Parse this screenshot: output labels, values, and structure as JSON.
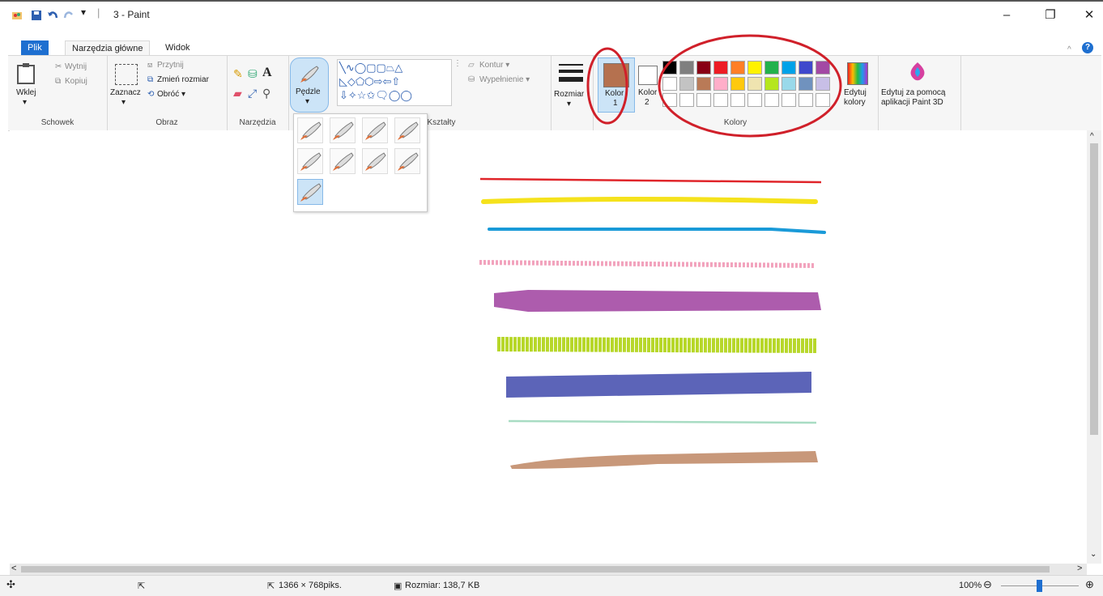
{
  "window": {
    "title": "3 - Paint",
    "minimize_glyph": "–",
    "maximize_glyph": "❐",
    "close_glyph": "✕"
  },
  "tabs": {
    "file": "Plik",
    "home": "Narzędzia główne",
    "view": "Widok"
  },
  "clipboard": {
    "paste": "Wklej",
    "cut": "Wytnij",
    "copy": "Kopiuj",
    "group": "Schowek"
  },
  "image": {
    "select": "Zaznacz",
    "crop": "Przytnij",
    "resize": "Zmień rozmiar",
    "rotate": "Obróć ▾",
    "group": "Obraz"
  },
  "tools": {
    "group": "Narzędzia",
    "text_glyph": "A"
  },
  "brushes": {
    "label": "Pędzle"
  },
  "shapes": {
    "outline": "Kontur ▾",
    "fill": "Wypełnienie ▾",
    "group": "Kształty",
    "row1": "╲∿◯▢▢⏢△",
    "row2": "◺◇⬠⬡⇨⇦⇧",
    "row3": "⇩✧☆✩🗨◯◯"
  },
  "size": {
    "label": "Rozmiar"
  },
  "colors": {
    "color1": "Kolor",
    "color1_num": "1",
    "color2": "Kolor",
    "color2_num": "2",
    "group": "Kolory",
    "edit": "Edytuj",
    "edit2": "kolory",
    "color1_value": "#b5714f",
    "palette_row1": [
      "#000000",
      "#7f7f7f",
      "#880015",
      "#ed1c24",
      "#ff7f27",
      "#fff200",
      "#22b14c",
      "#00a2e8",
      "#3f48cc",
      "#a349a4"
    ],
    "palette_row2": [
      "#ffffff",
      "#c3c3c3",
      "#b97a57",
      "#ffaec9",
      "#ffc90e",
      "#efe4b0",
      "#b5e61d",
      "#99d9ea",
      "#7092be",
      "#c8bfe7"
    ]
  },
  "paint3d": {
    "line1": "Edytuj za pomocą",
    "line2": "aplikacji Paint 3D"
  },
  "status": {
    "dimensions": "1366 × 768piks.",
    "filesize": "Rozmiar: 138,7 KB",
    "zoom": "100%"
  },
  "strokes": [
    {
      "color": "#e0252a",
      "style": "pen"
    },
    {
      "color": "#f5e21c",
      "style": "brush"
    },
    {
      "color": "#1a9ad8",
      "style": "brush"
    },
    {
      "color": "#f2a3bd",
      "style": "crayon"
    },
    {
      "color": "#a44aa4",
      "style": "calligraphy"
    },
    {
      "color": "#b7d72a",
      "style": "airbrush"
    },
    {
      "color": "#5c64b8",
      "style": "marker"
    },
    {
      "color": "#a8dcc3",
      "style": "pen"
    },
    {
      "color": "#c28d6c",
      "style": "watercolor"
    }
  ]
}
